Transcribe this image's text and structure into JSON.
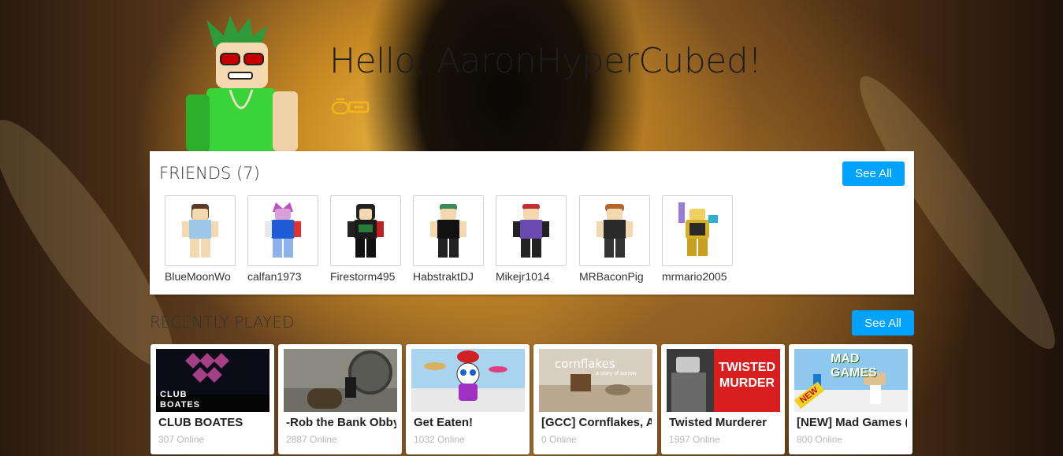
{
  "hero": {
    "greeting": "Hello, AaronHyperCubed!"
  },
  "friends": {
    "title": "FRIENDS (7)",
    "see_all": "See All",
    "items": [
      {
        "name": "BlueMoonWo"
      },
      {
        "name": "calfan1973"
      },
      {
        "name": "Firestorm495"
      },
      {
        "name": "HabstraktDJ"
      },
      {
        "name": "Mikejr1014"
      },
      {
        "name": "MRBaconPig"
      },
      {
        "name": "mrmario2005"
      }
    ]
  },
  "recently_played": {
    "title": "RECENTLY PLAYED",
    "see_all": "See All",
    "games": [
      {
        "name": "CLUB BOATES",
        "online": "307 Online",
        "thumb_text": "CLUB BOATES"
      },
      {
        "name": "-Rob the Bank Obby",
        "online": "2887 Online"
      },
      {
        "name": "Get Eaten!",
        "online": "1032 Online"
      },
      {
        "name": "[GCC] Cornflakes, A",
        "online": "0 Online",
        "thumb_text": "cornflakes",
        "thumb_sub": "a story of sorrow"
      },
      {
        "name": "Twisted Murderer",
        "online": "1997 Online",
        "thumb_text": "TWISTED MURDER"
      },
      {
        "name": "[NEW] Mad Games (",
        "online": "800 Online",
        "thumb_text": "MAD GAMES",
        "thumb_badge": "NEW"
      }
    ]
  }
}
